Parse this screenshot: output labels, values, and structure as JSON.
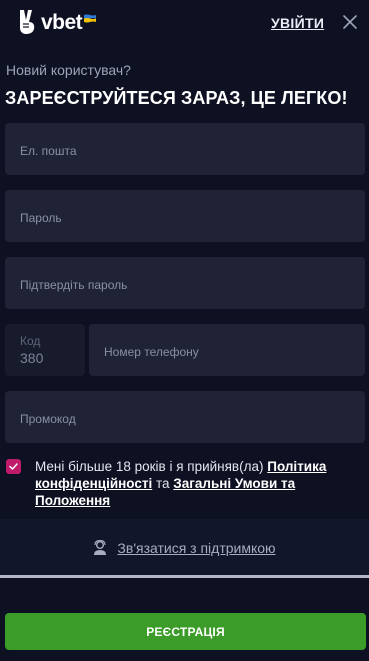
{
  "header": {
    "logo_text": "vbet",
    "login_label": "УВІЙТИ"
  },
  "subtitle": "Новий користувач?",
  "title": "ЗАРЕЄСТРУЙТЕСЯ ЗАРАЗ, ЦЕ ЛЕГКО!",
  "form": {
    "email_placeholder": "Ел. пошта",
    "password_placeholder": "Пароль",
    "confirm_placeholder": "Підтвердіть пароль",
    "code_label": "Код",
    "code_value": "380",
    "phone_placeholder": "Номер телефону",
    "promo_placeholder": "Промокод"
  },
  "consent": {
    "checked": true,
    "prefix": "Мені більше 18 років і я прийняв(ла) ",
    "privacy_link": "Політика конфіденційності",
    "middle": " та ",
    "terms_link": "Загальні Умови та Положення"
  },
  "support_label": "Зв'язатися з підтримкою",
  "register_button": "РЕЄСТРАЦІЯ",
  "colors": {
    "background": "#0d1122",
    "field": "#1f2335",
    "accent_checkbox": "#c01a6b",
    "register_green": "#3c9c2a"
  },
  "icons": [
    "victory-hand-logo-icon",
    "ukraine-flag-icon",
    "close-icon",
    "support-agent-icon",
    "checkmark-icon"
  ]
}
